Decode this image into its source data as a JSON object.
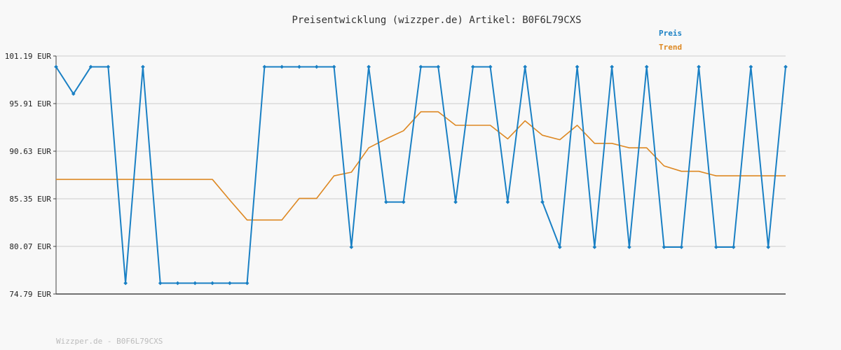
{
  "chart_data": {
    "type": "line",
    "title": "Preisentwicklung (wizzper.de) Artikel: B0F6L79CXS",
    "xlabel": "",
    "ylabel": "",
    "ylim": [
      74.79,
      101.19
    ],
    "yticks": [
      "74.79 EUR",
      "80.07 EUR",
      "85.35 EUR",
      "90.63 EUR",
      "95.91 EUR",
      "101.19 EUR"
    ],
    "ytick_values": [
      74.79,
      80.07,
      85.35,
      90.63,
      95.91,
      101.19
    ],
    "grid": true,
    "legend_position": "top-right",
    "series": [
      {
        "name": "Preis",
        "color": "#1a80c4",
        "values": [
          99.99,
          96.99,
          99.99,
          99.99,
          75.99,
          99.99,
          75.99,
          75.99,
          75.99,
          75.99,
          75.99,
          75.99,
          99.99,
          99.99,
          99.99,
          99.99,
          99.99,
          79.99,
          99.99,
          84.99,
          84.99,
          99.99,
          99.99,
          84.99,
          99.99,
          99.99,
          84.99,
          99.99,
          84.99,
          79.99,
          99.99,
          79.99,
          99.99,
          79.99,
          99.99,
          79.99,
          79.99,
          99.99,
          79.99,
          79.99,
          99.99,
          79.99,
          99.99
        ]
      },
      {
        "name": "Trend",
        "color": "#dd8822",
        "values": [
          87.5,
          87.5,
          87.5,
          87.5,
          87.5,
          87.5,
          87.5,
          87.5,
          87.5,
          87.5,
          85.2,
          83.0,
          83.0,
          83.0,
          85.4,
          85.4,
          87.9,
          88.3,
          91.0,
          92.0,
          92.9,
          95.0,
          95.0,
          93.5,
          93.5,
          93.5,
          92.0,
          94.0,
          92.4,
          91.9,
          93.5,
          91.5,
          91.5,
          91.0,
          91.0,
          89.0,
          88.4,
          88.4,
          87.9,
          87.9,
          87.9,
          87.9,
          87.9
        ]
      }
    ]
  },
  "footer": "Wizzper.de - B0F6L79CXS"
}
